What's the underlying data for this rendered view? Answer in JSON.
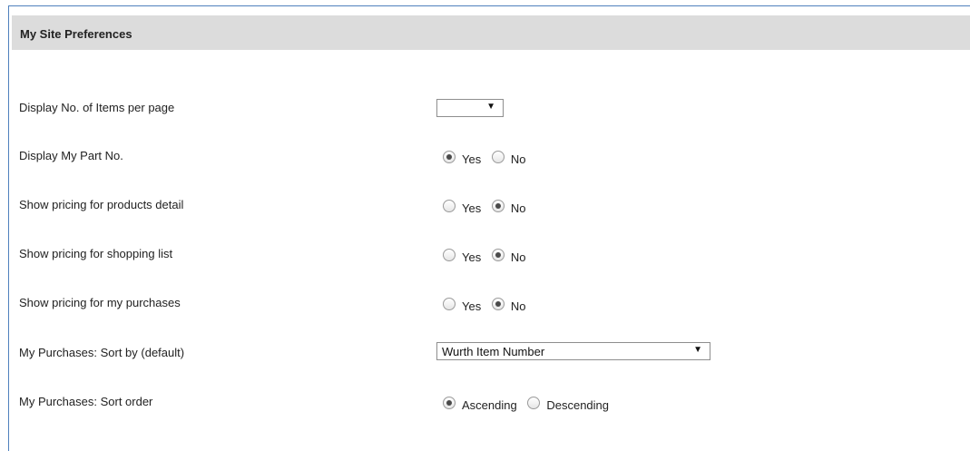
{
  "section": {
    "title": "My Site Preferences"
  },
  "prefs": {
    "items_per_page": {
      "label": "Display No. of Items per page",
      "selected": ""
    },
    "display_part_no": {
      "label": "Display My Part No.",
      "options": [
        "Yes",
        "No"
      ],
      "selected": "Yes"
    },
    "pricing_products_detail": {
      "label": "Show pricing for products detail",
      "options": [
        "Yes",
        "No"
      ],
      "selected": "No"
    },
    "pricing_shopping_list": {
      "label": "Show pricing for shopping list",
      "options": [
        "Yes",
        "No"
      ],
      "selected": "No"
    },
    "pricing_my_purchases": {
      "label": "Show pricing for my purchases",
      "options": [
        "Yes",
        "No"
      ],
      "selected": "No"
    },
    "purchases_sort_by": {
      "label": "My Purchases: Sort by (default)",
      "selected": "Wurth Item Number"
    },
    "purchases_sort_order": {
      "label": "My Purchases: Sort order",
      "options": [
        "Ascending",
        "Descending"
      ],
      "selected": "Ascending"
    }
  },
  "icons": {
    "dropdown_arrow": "▼"
  }
}
